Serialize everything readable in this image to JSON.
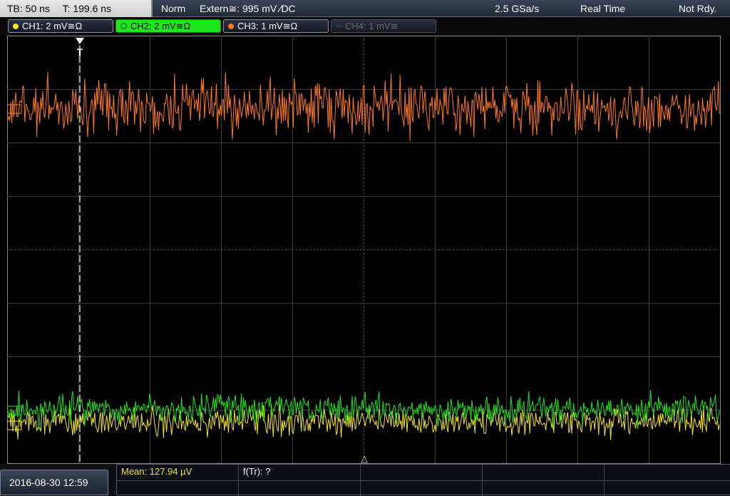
{
  "status": {
    "timebase": "TB: 50 ns",
    "trigger_time": "T: 199.6 ns",
    "trigger_mode": "Norm",
    "trigger_source": "Extern≅: 995 mV ⁄DC",
    "sample_rate": "2.5 GSa/s",
    "acq_mode": "Real Time",
    "ready_state": "Not Rdy."
  },
  "channels": [
    {
      "label": "CH1: 2 mV≅Ω",
      "color": "#f5e61e",
      "state": "on"
    },
    {
      "label": "CH2: 2 mV≅Ω",
      "color": "#1ee61e",
      "state": "selected"
    },
    {
      "label": "CH3: 1 mV≅Ω",
      "color": "#ff7a1e",
      "state": "on"
    },
    {
      "label": "CH4: 1 mV≅",
      "color": "#6a6a6a",
      "state": "off"
    }
  ],
  "trigger_marker": "T",
  "measurements": {
    "mean": "Mean: 127.94 µV",
    "frequency": "f(Tr): ?"
  },
  "datetime": "2016-08-30 12:59",
  "colors": {
    "ch1": "#f5e61e",
    "ch2": "#1ee61e",
    "ch3": "#ff7a1e"
  }
}
